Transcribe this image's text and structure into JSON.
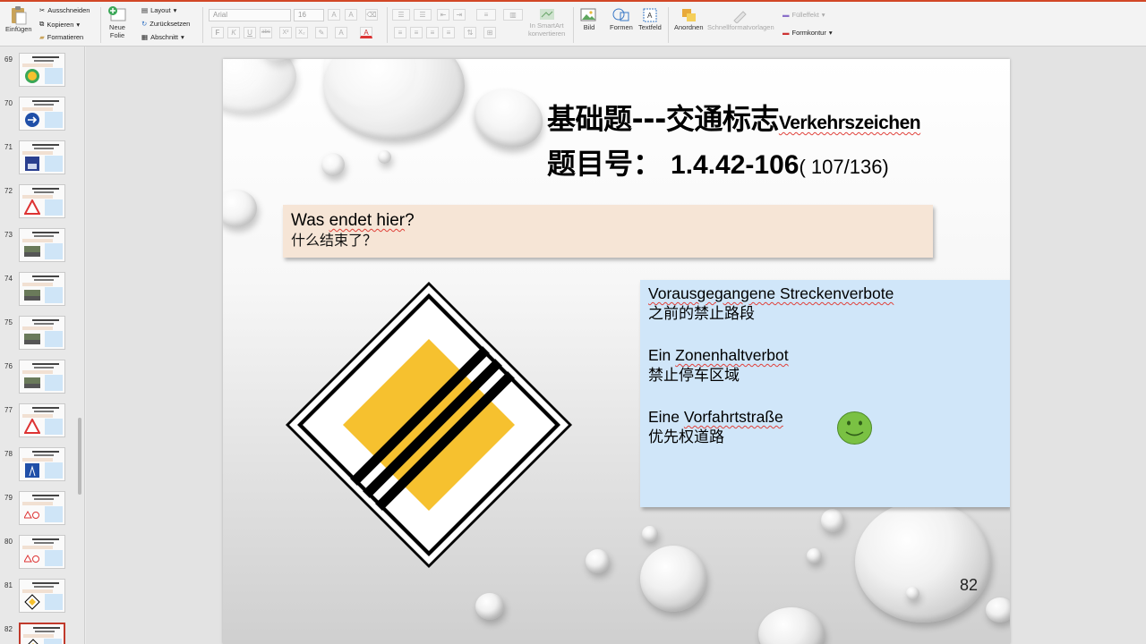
{
  "ribbon": {
    "paste_label": "Einfügen",
    "cut_label": "Ausschneiden",
    "copy_label": "Kopieren",
    "format_label": "Formatieren",
    "new_slide_label_1": "Neue",
    "new_slide_label_2": "Folie",
    "layout_label": "Layout",
    "reset_label": "Zurücksetzen",
    "section_label": "Abschnitt",
    "font_name": "Arial",
    "font_size": "16",
    "bold": "F",
    "italic": "K",
    "underline": "U",
    "strike": "abc",
    "superscript": "X²",
    "subscript": "X₂",
    "smartart_label_1": "In SmartArt",
    "smartart_label_2": "konvertieren",
    "picture_label": "Bild",
    "shapes_label": "Formen",
    "textbox_label": "Textfeld",
    "arrange_label": "Anordnen",
    "quickstyles_label": "Schnellformatvorlagen",
    "fill_effect_label": "Fülleffekt",
    "shape_outline_label": "Formkontur",
    "accent_color": "#d24726"
  },
  "thumbnails": [
    {
      "num": "69",
      "pic": "circle-green"
    },
    {
      "num": "70",
      "pic": "circle-blue"
    },
    {
      "num": "71",
      "pic": "photo-blue"
    },
    {
      "num": "72",
      "pic": "triangle-warning"
    },
    {
      "num": "73",
      "pic": "photo-road"
    },
    {
      "num": "74",
      "pic": "photo-road"
    },
    {
      "num": "75",
      "pic": "photo-road"
    },
    {
      "num": "76",
      "pic": "photo-road"
    },
    {
      "num": "77",
      "pic": "triangle-warning"
    },
    {
      "num": "78",
      "pic": "square-blue"
    },
    {
      "num": "79",
      "pic": "small-signs"
    },
    {
      "num": "80",
      "pic": "small-signs"
    },
    {
      "num": "81",
      "pic": "diamond-yellow"
    },
    {
      "num": "82",
      "pic": "diamond-yellow",
      "selected": true
    }
  ],
  "slide": {
    "title_zh": "基础题---交通标志",
    "title_de": "Verkehrszeichen",
    "subtitle_zh": "题目号：",
    "question_number": "1.4.42-106",
    "question_count": "( 107/136)",
    "question_de_1": "Was ",
    "question_de_2": "endet hier",
    "question_de_3": "?",
    "question_zh": "什么结束了？",
    "answers": [
      {
        "de_pre": "",
        "de_marked": "Vorausgegangene Streckenverbote",
        "zh": "之前的禁止路段"
      },
      {
        "de_pre": "Ein ",
        "de_marked": "Zonenhaltverbot",
        "zh": "禁止停车区域"
      },
      {
        "de_pre": "Eine ",
        "de_marked": "Vorfahrtstraße",
        "zh": "优先权道路"
      }
    ],
    "correct_marker": "smiley-icon",
    "page_number": "82",
    "sign": "end-of-priority-road-sign",
    "colors": {
      "question_bg": "#f6e5d6",
      "answer_bg": "#d0e6f9",
      "sign_yellow": "#f6c12f",
      "smiley_green": "#7ac143"
    }
  }
}
